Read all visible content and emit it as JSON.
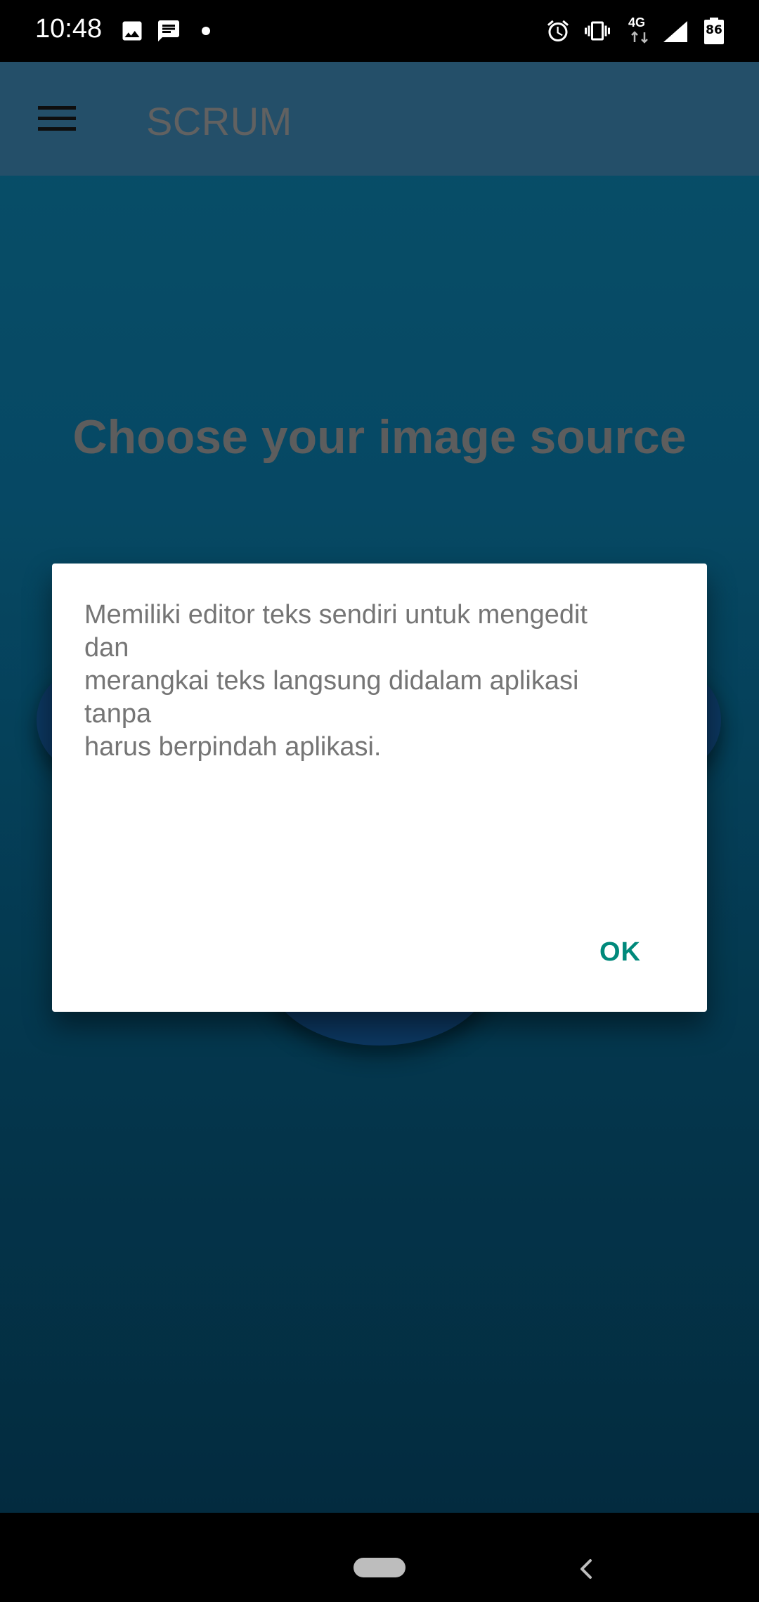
{
  "status_bar": {
    "time": "10:48",
    "network": "4G",
    "battery_level": "86",
    "icons": [
      "image-icon",
      "message-icon",
      "dot-icon",
      "alarm-icon",
      "vibrate-icon",
      "network-4g-icon",
      "signal-icon",
      "battery-icon"
    ]
  },
  "app_bar": {
    "title": "SCRUM",
    "menu_icon": "hamburger-menu-icon"
  },
  "main": {
    "heading": "Choose your image source"
  },
  "dialog": {
    "message": "Memiliki editor teks sendiri untuk mengedit\ndan\nmerangkai teks langsung didalam aplikasi\ntanpa\nharus berpindah aplikasi.",
    "ok_label": "OK"
  },
  "nav_bar": {
    "icons": [
      "home-pill-icon",
      "back-icon"
    ]
  },
  "colors": {
    "accent": "#00897b",
    "app_bar": "#2a5a78",
    "background_top": "#0a5a78",
    "background_bottom": "#043248"
  }
}
